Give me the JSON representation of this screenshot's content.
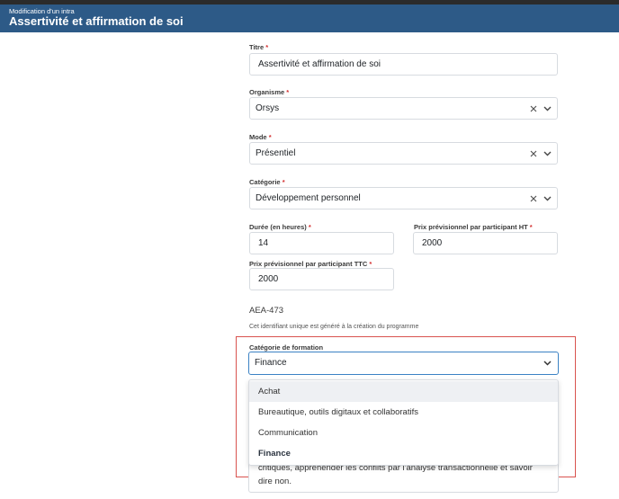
{
  "header": {
    "subtitle": "Modification d'un intra",
    "title": "Assertivité et affirmation de soi"
  },
  "form": {
    "titre": {
      "label": "Titre",
      "value": "Assertivité et affirmation de soi"
    },
    "organisme": {
      "label": "Organisme",
      "value": "Orsys"
    },
    "mode": {
      "label": "Mode",
      "value": "Présentiel"
    },
    "categorie": {
      "label": "Catégorie",
      "value": "Développement personnel"
    },
    "duree": {
      "label": "Durée (en heures)",
      "value": "14"
    },
    "prix_ht": {
      "label": "Prix prévisionnel par participant HT",
      "value": "2000"
    },
    "prix_ttc": {
      "label": "Prix prévisionnel par participant TTC",
      "value": "2000"
    },
    "required_marker": "*",
    "identifier": {
      "value": "AEA-473",
      "help": "Cet identifiant unique est généré à la création du programme"
    },
    "categorie_formation": {
      "label": "Catégorie de formation",
      "value": "Finance",
      "options": [
        "Achat",
        "Bureautique, outils digitaux et collaboratifs",
        "Communication",
        "Finance"
      ]
    },
    "description_partial": {
      "line1": "critiques, appréhender les conflits par l'analyse transactionnelle et savoir",
      "line2": "dire non."
    }
  },
  "colors": {
    "header_bg": "#2d5a87",
    "required": "#d32f2f",
    "focus": "#3b82c4",
    "highlight_box": "#d9534f"
  },
  "icons": {
    "clear": "close-icon",
    "dropdown": "chevron-down-icon"
  }
}
